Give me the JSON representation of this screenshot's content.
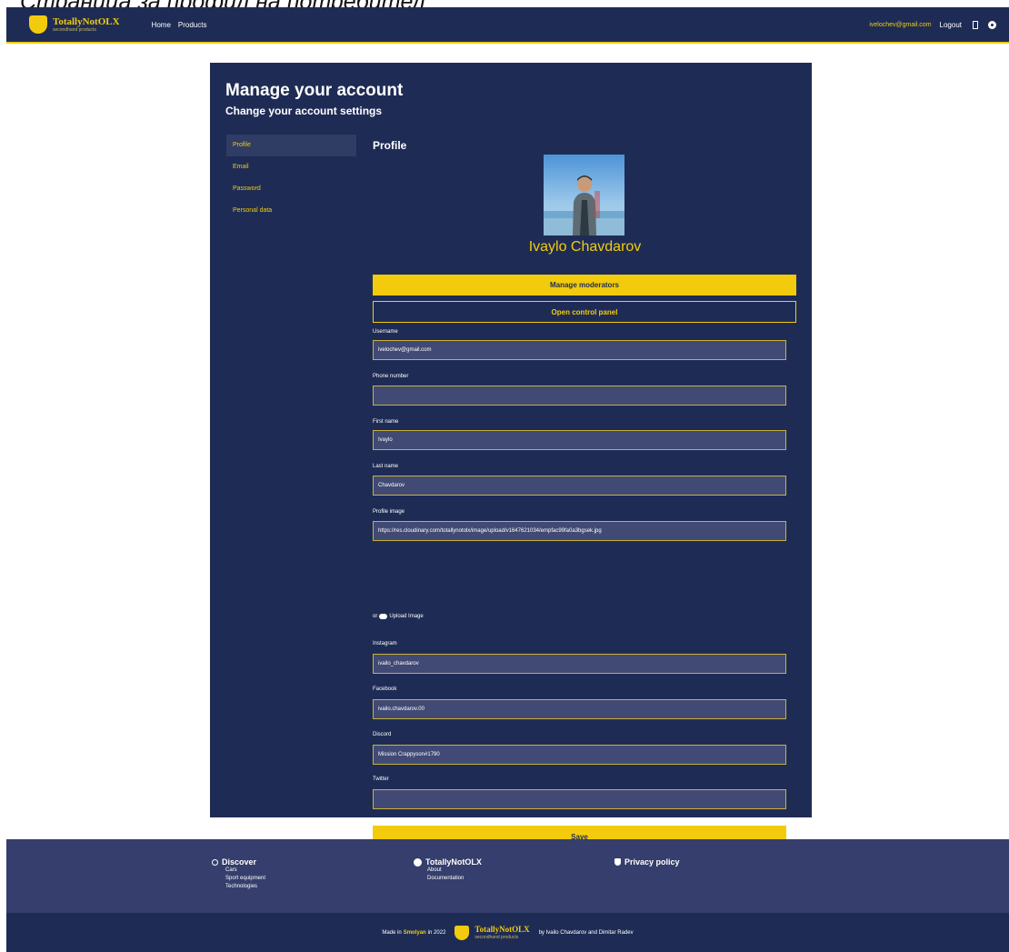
{
  "caption": "Страница за профил на потребител",
  "navbar": {
    "brand": "TotallyNotOLX",
    "brand_slogan": "secondhand products",
    "links": [
      "Home",
      "Products"
    ],
    "user_email": "ivelochev@gmail.com",
    "logout": "Logout"
  },
  "account": {
    "title": "Manage your account",
    "subtitle": "Change your account settings",
    "sidebar": [
      "Profile",
      "Email",
      "Password",
      "Personal data"
    ],
    "section_title": "Profile",
    "full_name": "Ivaylo Chavdarov",
    "manage_moderators": "Manage moderators",
    "open_control_panel": "Open control panel",
    "fields": {
      "username": {
        "label": "Username",
        "value": "ivelochev@gmail.com"
      },
      "phone": {
        "label": "Phone number",
        "value": ""
      },
      "first_name": {
        "label": "First name",
        "value": "Ivaylo"
      },
      "last_name": {
        "label": "Last name",
        "value": "Chavdarov"
      },
      "profile_image": {
        "label": "Profile image",
        "value": "https://res.cloudinary.com/totallynotolx/image/upload/v1647621034/empfac99fa0a3bgsek.jpg"
      },
      "instagram": {
        "label": "Instagram",
        "value": "ivailo_chavdarov"
      },
      "facebook": {
        "label": "Facebook",
        "value": "ivailo.chavdarov.00"
      },
      "discord": {
        "label": "Discord",
        "value": "Mission Crappyson#1790"
      },
      "twitter": {
        "label": "Twitter",
        "value": ""
      }
    },
    "upload_or": "or",
    "upload_label": "Upload Image",
    "save": "Save"
  },
  "footer": {
    "discover_title": "Discover",
    "discover_links": [
      "Cars",
      "Sport equipment",
      "Technologies"
    ],
    "brand_title": "TotallyNotOLX",
    "brand_links": [
      "About",
      "Documentation"
    ],
    "privacy_title": "Privacy policy",
    "bottom_made": "Made in",
    "bottom_place": "Smolyan",
    "bottom_year": "in 2022",
    "bottom_credits": "by Ivailo Chavdarov and Dimitar Radev"
  },
  "colors": {
    "navy": "#1e2c55",
    "accent": "#f2cc0c",
    "footer": "#353e6c"
  },
  "icons": [
    "bookmark-icon",
    "gear-icon",
    "cloud-upload-icon",
    "search-icon",
    "info-circle-icon",
    "shield-icon"
  ]
}
